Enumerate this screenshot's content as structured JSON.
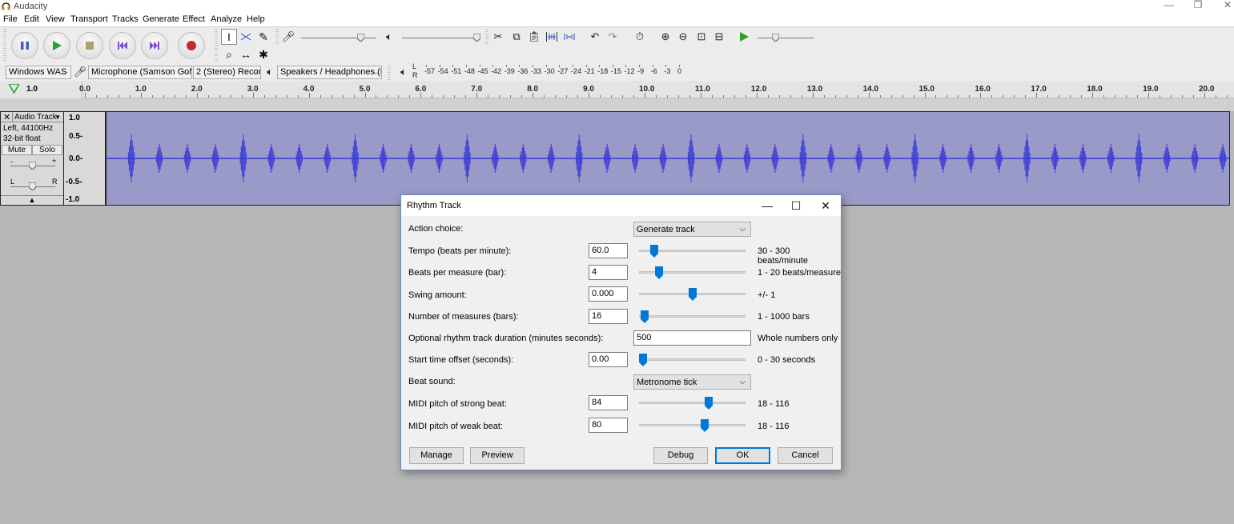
{
  "app": {
    "title": "Audacity",
    "controls": {
      "minimize": "—",
      "restore": "❐",
      "close": "✕"
    }
  },
  "menu": [
    "File",
    "Edit",
    "View",
    "Transport",
    "Tracks",
    "Generate",
    "Effect",
    "Analyze",
    "Help"
  ],
  "transport": {
    "buttons": [
      {
        "name": "pause-button",
        "icon": "pause-icon"
      },
      {
        "name": "play-button",
        "icon": "play-icon"
      },
      {
        "name": "stop-button",
        "icon": "stop-icon"
      },
      {
        "name": "skip-start-button",
        "icon": "skip-start-icon"
      },
      {
        "name": "skip-end-button",
        "icon": "skip-end-icon"
      },
      {
        "name": "record-button",
        "icon": "record-icon"
      }
    ]
  },
  "devices": {
    "host": "Windows WAS",
    "recording_device": "Microphone (Samson GoN",
    "channels": "2 (Stereo) Recor",
    "playback_device": "Speakers / Headphones (R"
  },
  "meter": {
    "L": "L",
    "R": "R",
    "ticks": [
      "-57",
      "-54",
      "-51",
      "-48",
      "-45",
      "-42",
      "-39",
      "-36",
      "-33",
      "-30",
      "-27",
      "-24",
      "-21",
      "-18",
      "-15",
      "-12",
      "-9",
      "-6",
      "-3",
      "0"
    ]
  },
  "ruler": {
    "left_value": "1.0",
    "labels": [
      "0.0",
      "1.0",
      "2.0",
      "3.0",
      "4.0",
      "5.0",
      "6.0",
      "7.0",
      "8.0",
      "9.0",
      "10.0",
      "11.0",
      "12.0",
      "13.0",
      "14.0",
      "15.0",
      "16.0",
      "17.0",
      "18.0",
      "19.0",
      "20.0"
    ]
  },
  "track": {
    "name": "Audio Track",
    "info1": "Left, 44100Hz",
    "info2": "32-bit float",
    "mute": "Mute",
    "solo": "Solo",
    "gain_minus": "-",
    "gain_plus": "+",
    "pan_left": "L",
    "pan_right": "R",
    "scale": [
      "1.0",
      "0.5-",
      "0.0-",
      "-0.5-",
      "-1.0"
    ]
  },
  "dialog": {
    "title": "Rhythm Track",
    "action_label": "Action choice:",
    "action_value": "Generate track",
    "tempo_label": "Tempo (beats per minute):",
    "tempo_value": "60.0",
    "tempo_range": "30 - 300 beats/minute",
    "tempo_fraction": 0.11,
    "bpm_label": "Beats per measure (bar):",
    "bpm_value": "4",
    "bpm_range": "1 - 20 beats/measure",
    "bpm_fraction": 0.16,
    "swing_label": "Swing amount:",
    "swing_value": "0.000",
    "swing_range": "+/- 1",
    "swing_fraction": 0.5,
    "measures_label": "Number of measures (bars):",
    "measures_value": "16",
    "measures_range": "1 - 1000 bars",
    "measures_fraction": 0.015,
    "duration_label": "Optional rhythm track duration (minutes seconds):",
    "duration_value": "500",
    "duration_note": "Whole numbers only",
    "offset_label": "Start time offset (seconds):",
    "offset_value": "0.00",
    "offset_range": "0 - 30 seconds",
    "offset_fraction": 0.0,
    "beat_label": "Beat sound:",
    "beat_value": "Metronome tick",
    "strong_label": "MIDI pitch of strong beat:",
    "strong_value": "84",
    "strong_range": "18 - 116",
    "strong_fraction": 0.67,
    "weak_label": "MIDI pitch of weak beat:",
    "weak_value": "80",
    "weak_range": "18 - 116",
    "weak_fraction": 0.63,
    "buttons": {
      "manage": "Manage",
      "preview": "Preview",
      "debug": "Debug",
      "ok": "OK",
      "cancel": "Cancel"
    }
  },
  "colors": {
    "waveform_bg": "#9a9ac8",
    "waveform": "#3a3ad8",
    "accent": "#0078d7"
  }
}
